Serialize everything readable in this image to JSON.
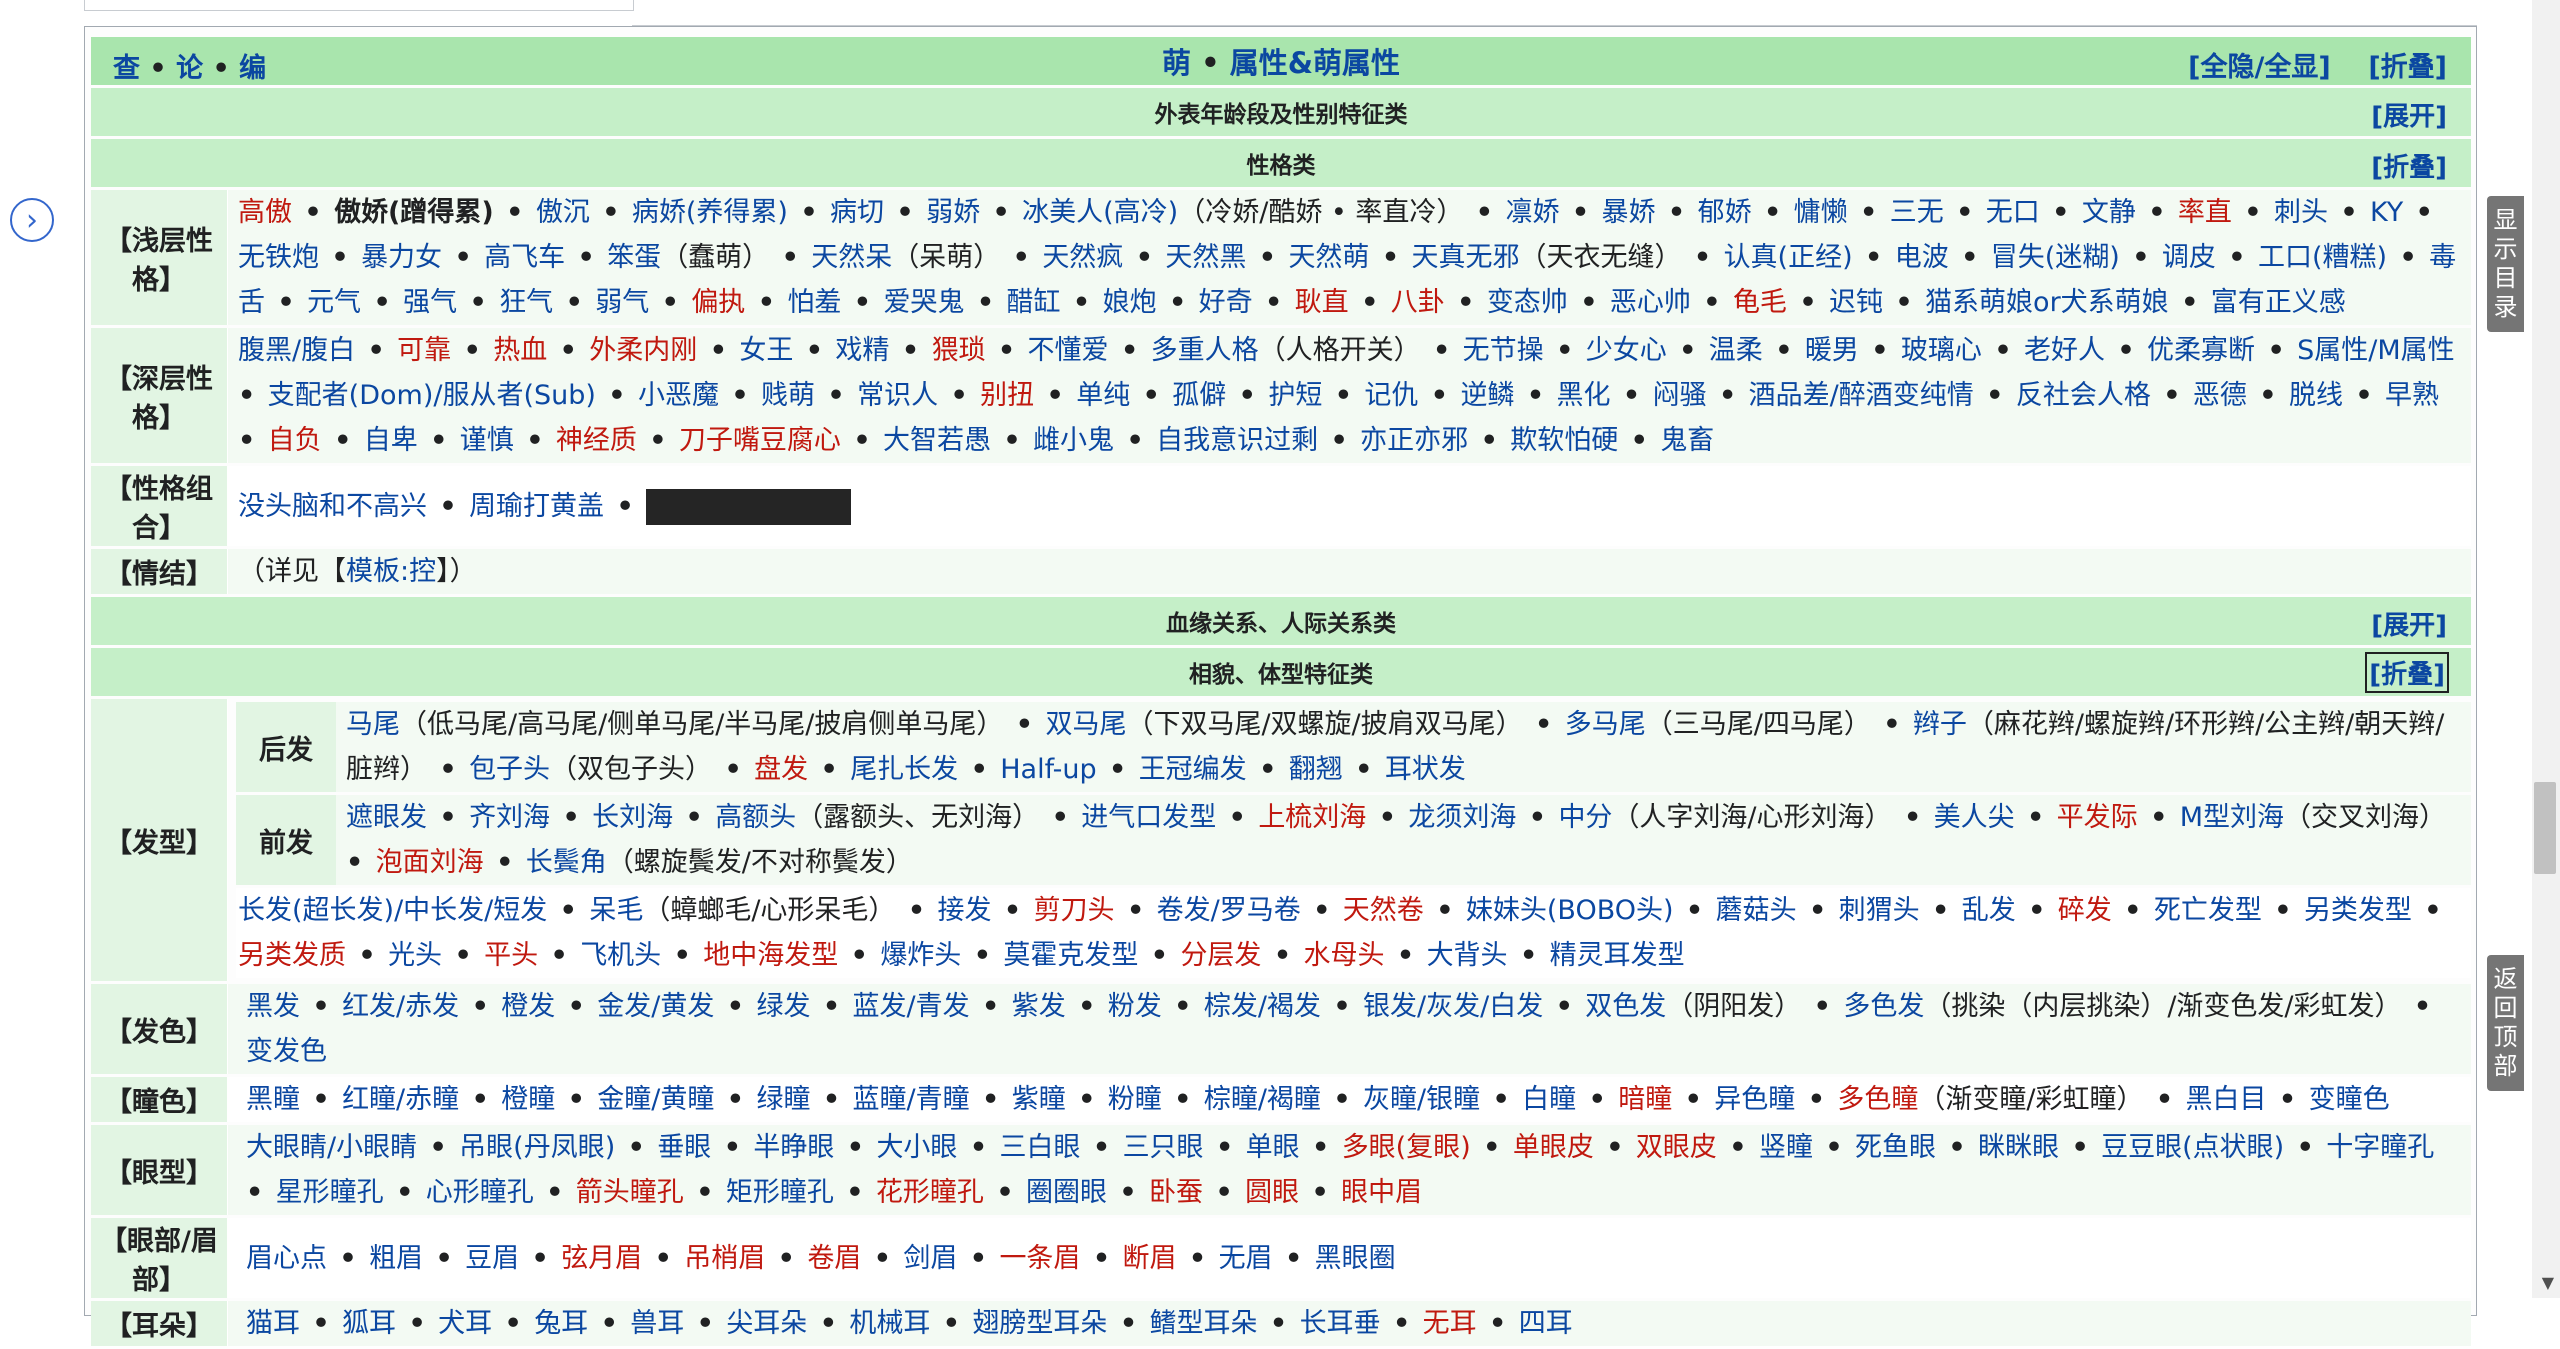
{
  "nav": {
    "view": "查",
    "talk": "论",
    "edit": "编",
    "dot": "•"
  },
  "title": {
    "part1": "萌",
    "part2": "属性&萌属性",
    "toggle_all": "[全隐/全显]",
    "collapse": "[折叠]"
  },
  "groups": {
    "age": {
      "title": "外表年龄段及性别特征类",
      "toggle": "[展开]"
    },
    "personality": {
      "title": "性格类",
      "toggle": "[折叠]"
    },
    "relations": {
      "title": "血缘关系、人际关系类",
      "toggle": "[展开]"
    },
    "appearance": {
      "title": "相貌、体型特征类",
      "toggle": "[折叠]"
    }
  },
  "labels": {
    "shallow": "【浅层性格】",
    "deep": "【深层性格】",
    "combo": "【性格组合】",
    "complex": "【情结】",
    "hair": "【发型】",
    "back_hair": "后发",
    "front_hair": "前发",
    "hair_color": "【发色】",
    "eye_color": "【瞳色】",
    "eye_shape": "【眼型】",
    "eye_brow": "【眼部/眉部】",
    "ears": "【耳朵】"
  },
  "rows": {
    "shallow": [
      {
        "t": "高傲",
        "s": "red"
      },
      {
        "t": "傲娇(蹭得累)",
        "s": "bold"
      },
      {
        "t": "傲沉"
      },
      {
        "t": "病娇(养得累)"
      },
      {
        "t": "病切"
      },
      {
        "t": "弱娇"
      },
      {
        "t": "冰美人(高冷)",
        "after": "（冷娇/酷娇 • 率直冷）"
      },
      {
        "t": "凛娇"
      },
      {
        "t": "暴娇"
      },
      {
        "t": "郁娇"
      },
      {
        "t": "慵懒"
      },
      {
        "t": "三无"
      },
      {
        "t": "无口"
      },
      {
        "t": "文静"
      },
      {
        "t": "率直",
        "s": "red"
      },
      {
        "t": "刺头"
      },
      {
        "t": "KY"
      },
      {
        "t": "无铁炮"
      },
      {
        "t": "暴力女"
      },
      {
        "t": "高飞车"
      },
      {
        "t": "笨蛋",
        "after": "（蠢萌）"
      },
      {
        "t": "天然呆",
        "after": "（呆萌）"
      },
      {
        "t": "天然疯"
      },
      {
        "t": "天然黑"
      },
      {
        "t": "天然萌"
      },
      {
        "t": "天真无邪",
        "after": "（天衣无缝）"
      },
      {
        "t": "认真(正经)"
      },
      {
        "t": "电波"
      },
      {
        "t": "冒失(迷糊)"
      },
      {
        "t": "调皮"
      },
      {
        "t": "工口(糟糕)"
      },
      {
        "t": "毒舌"
      },
      {
        "t": "元气"
      },
      {
        "t": "强气"
      },
      {
        "t": "狂气"
      },
      {
        "t": "弱气"
      },
      {
        "t": "偏执",
        "s": "red"
      },
      {
        "t": "怕羞"
      },
      {
        "t": "爱哭鬼"
      },
      {
        "t": "醋缸"
      },
      {
        "t": "娘炮"
      },
      {
        "t": "好奇"
      },
      {
        "t": "耿直",
        "s": "red"
      },
      {
        "t": "八卦",
        "s": "red"
      },
      {
        "t": "变态帅"
      },
      {
        "t": "恶心帅"
      },
      {
        "t": "龟毛",
        "s": "red"
      },
      {
        "t": "迟钝"
      },
      {
        "t": "猫系萌娘or犬系萌娘"
      },
      {
        "t": "富有正义感"
      }
    ],
    "deep": [
      {
        "t": "腹黑/腹白"
      },
      {
        "t": "可靠",
        "s": "red"
      },
      {
        "t": "热血",
        "s": "red"
      },
      {
        "t": "外柔内刚",
        "s": "red"
      },
      {
        "t": "女王"
      },
      {
        "t": "戏精"
      },
      {
        "t": "猥琐",
        "s": "red"
      },
      {
        "t": "不懂爱"
      },
      {
        "t": "多重人格",
        "after": "（人格开关）"
      },
      {
        "t": "无节操"
      },
      {
        "t": "少女心"
      },
      {
        "t": "温柔"
      },
      {
        "t": "暖男"
      },
      {
        "t": "玻璃心"
      },
      {
        "t": "老好人"
      },
      {
        "t": "优柔寡断"
      },
      {
        "t": "S属性/M属性"
      },
      {
        "t": "支配者(Dom)/服从者(Sub)"
      },
      {
        "t": "小恶魔"
      },
      {
        "t": "贱萌"
      },
      {
        "t": "常识人"
      },
      {
        "t": "别扭",
        "s": "red"
      },
      {
        "t": "单纯"
      },
      {
        "t": "孤僻"
      },
      {
        "t": "护短"
      },
      {
        "t": "记仇"
      },
      {
        "t": "逆鳞"
      },
      {
        "t": "黑化"
      },
      {
        "t": "闷骚"
      },
      {
        "t": "酒品差/醉酒变纯情"
      },
      {
        "t": "反社会人格"
      },
      {
        "t": "恶德"
      },
      {
        "t": "脱线"
      },
      {
        "t": "早熟"
      },
      {
        "t": "自负",
        "s": "red"
      },
      {
        "t": "自卑"
      },
      {
        "t": "谨慎"
      },
      {
        "t": "神经质",
        "s": "red"
      },
      {
        "t": "刀子嘴豆腐心",
        "s": "red"
      },
      {
        "t": "大智若愚"
      },
      {
        "t": "雌小鬼"
      },
      {
        "t": "自我意识过剩"
      },
      {
        "t": "亦正亦邪"
      },
      {
        "t": "欺软怕硬"
      },
      {
        "t": "鬼畜"
      }
    ],
    "combo": [
      {
        "t": "没头脑和不高兴"
      },
      {
        "t": "周瑜打黄盖"
      }
    ],
    "complex": {
      "prefix": "（详见【",
      "link": "模板:控",
      "suffix": "】）"
    },
    "back_hair": [
      {
        "t": "马尾",
        "after": "（低马尾/高马尾/侧单马尾/半马尾/披肩侧单马尾）"
      },
      {
        "t": "双马尾",
        "after": "（下双马尾/双螺旋/披肩双马尾）"
      },
      {
        "t": "多马尾",
        "after": "（三马尾/四马尾）"
      },
      {
        "t": "辫子",
        "after": "（麻花辫/螺旋辫/环形辫/公主辫/朝天辫/脏辫）"
      },
      {
        "t": "包子头",
        "after": "（双包子头）"
      },
      {
        "t": "盘发",
        "s": "red"
      },
      {
        "t": "尾扎长发"
      },
      {
        "t": "Half-up"
      },
      {
        "t": "王冠编发"
      },
      {
        "t": "翻翘"
      },
      {
        "t": "耳状发"
      }
    ],
    "front_hair": [
      {
        "t": "遮眼发"
      },
      {
        "t": "齐刘海"
      },
      {
        "t": "长刘海"
      },
      {
        "t": "高额头",
        "after": "（露额头、无刘海）"
      },
      {
        "t": "进气口发型"
      },
      {
        "t": "上梳刘海",
        "s": "red"
      },
      {
        "t": "龙须刘海"
      },
      {
        "t": "中分",
        "after": "（人字刘海/心形刘海）"
      },
      {
        "t": "美人尖"
      },
      {
        "t": "平发际",
        "s": "red"
      },
      {
        "t": "M型刘海",
        "after": "（交叉刘海）"
      },
      {
        "t": "泡面刘海",
        "s": "red"
      },
      {
        "t": "长鬓角",
        "after": "（螺旋鬓发/不对称鬓发）"
      }
    ],
    "other_hair": [
      {
        "t": "长发(超长发)/中长发/短发"
      },
      {
        "t": "呆毛",
        "after": "（蟑螂毛/心形呆毛）"
      },
      {
        "t": "接发"
      },
      {
        "t": "剪刀头",
        "s": "red"
      },
      {
        "t": "卷发/罗马卷"
      },
      {
        "t": "天然卷",
        "s": "red"
      },
      {
        "t": "妹妹头(BOBO头)"
      },
      {
        "t": "蘑菇头"
      },
      {
        "t": "刺猬头"
      },
      {
        "t": "乱发"
      },
      {
        "t": "碎发",
        "s": "red"
      },
      {
        "t": "死亡发型"
      },
      {
        "t": "另类发型"
      },
      {
        "t": "另类发质",
        "s": "red"
      },
      {
        "t": "光头"
      },
      {
        "t": "平头",
        "s": "red"
      },
      {
        "t": "飞机头"
      },
      {
        "t": "地中海发型",
        "s": "red"
      },
      {
        "t": "爆炸头"
      },
      {
        "t": "莫霍克发型"
      },
      {
        "t": "分层发",
        "s": "red"
      },
      {
        "t": "水母头",
        "s": "red"
      },
      {
        "t": "大背头"
      },
      {
        "t": "精灵耳发型"
      }
    ],
    "hair_color": [
      {
        "t": "黑发"
      },
      {
        "t": "红发/赤发"
      },
      {
        "t": "橙发"
      },
      {
        "t": "金发/黄发"
      },
      {
        "t": "绿发"
      },
      {
        "t": "蓝发/青发"
      },
      {
        "t": "紫发"
      },
      {
        "t": "粉发"
      },
      {
        "t": "棕发/褐发"
      },
      {
        "t": "银发/灰发/白发"
      },
      {
        "t": "双色发",
        "after": "（阴阳发）"
      },
      {
        "t": "多色发",
        "after": "（挑染（内层挑染）/渐变色发/彩虹发）"
      },
      {
        "t": "变发色"
      }
    ],
    "eye_color": [
      {
        "t": "黑瞳"
      },
      {
        "t": "红瞳/赤瞳"
      },
      {
        "t": "橙瞳"
      },
      {
        "t": "金瞳/黄瞳"
      },
      {
        "t": "绿瞳"
      },
      {
        "t": "蓝瞳/青瞳"
      },
      {
        "t": "紫瞳"
      },
      {
        "t": "粉瞳"
      },
      {
        "t": "棕瞳/褐瞳"
      },
      {
        "t": "灰瞳/银瞳"
      },
      {
        "t": "白瞳"
      },
      {
        "t": "暗瞳",
        "s": "red"
      },
      {
        "t": "异色瞳"
      },
      {
        "t": "多色瞳",
        "s": "red",
        "after": "（渐变瞳/彩虹瞳）"
      },
      {
        "t": "黑白目"
      },
      {
        "t": "变瞳色"
      }
    ],
    "eye_shape": [
      {
        "t": "大眼睛/小眼睛"
      },
      {
        "t": "吊眼(丹凤眼)"
      },
      {
        "t": "垂眼"
      },
      {
        "t": "半睁眼"
      },
      {
        "t": "大小眼"
      },
      {
        "t": "三白眼"
      },
      {
        "t": "三只眼"
      },
      {
        "t": "单眼"
      },
      {
        "t": "多眼(复眼)",
        "s": "red"
      },
      {
        "t": "单眼皮",
        "s": "red"
      },
      {
        "t": "双眼皮",
        "s": "red"
      },
      {
        "t": "竖瞳"
      },
      {
        "t": "死鱼眼"
      },
      {
        "t": "眯眯眼"
      },
      {
        "t": "豆豆眼(点状眼)"
      },
      {
        "t": "十字瞳孔"
      },
      {
        "t": "星形瞳孔"
      },
      {
        "t": "心形瞳孔"
      },
      {
        "t": "箭头瞳孔",
        "s": "red"
      },
      {
        "t": "矩形瞳孔"
      },
      {
        "t": "花形瞳孔",
        "s": "red"
      },
      {
        "t": "圈圈眼"
      },
      {
        "t": "卧蚕",
        "s": "red"
      },
      {
        "t": "圆眼",
        "s": "red"
      },
      {
        "t": "眼中眉",
        "s": "red"
      }
    ],
    "eye_brow": [
      {
        "t": "眉心点"
      },
      {
        "t": "粗眉"
      },
      {
        "t": "豆眉"
      },
      {
        "t": "弦月眉",
        "s": "red"
      },
      {
        "t": "吊梢眉",
        "s": "red"
      },
      {
        "t": "卷眉",
        "s": "red"
      },
      {
        "t": "剑眉"
      },
      {
        "t": "一条眉",
        "s": "red"
      },
      {
        "t": "断眉",
        "s": "red"
      },
      {
        "t": "无眉"
      },
      {
        "t": "黑眼圈"
      }
    ],
    "ears": [
      {
        "t": "猫耳"
      },
      {
        "t": "狐耳"
      },
      {
        "t": "犬耳"
      },
      {
        "t": "兔耳"
      },
      {
        "t": "兽耳"
      },
      {
        "t": "尖耳朵"
      },
      {
        "t": "机械耳"
      },
      {
        "t": "翅膀型耳朵"
      },
      {
        "t": "鳍型耳朵"
      },
      {
        "t": "长耳垂"
      },
      {
        "t": "无耳",
        "s": "red"
      },
      {
        "t": "四耳"
      }
    ]
  },
  "side": {
    "toc": "显示目录",
    "back_top": "返回顶部",
    "collapse_arrow": "›"
  },
  "colors": {
    "title_bg": "#a9e5ad",
    "group_bg": "#c5efc8",
    "label_bg": "#e2f5e3",
    "link": "#0b47a1",
    "red_link": "#c0190f"
  }
}
